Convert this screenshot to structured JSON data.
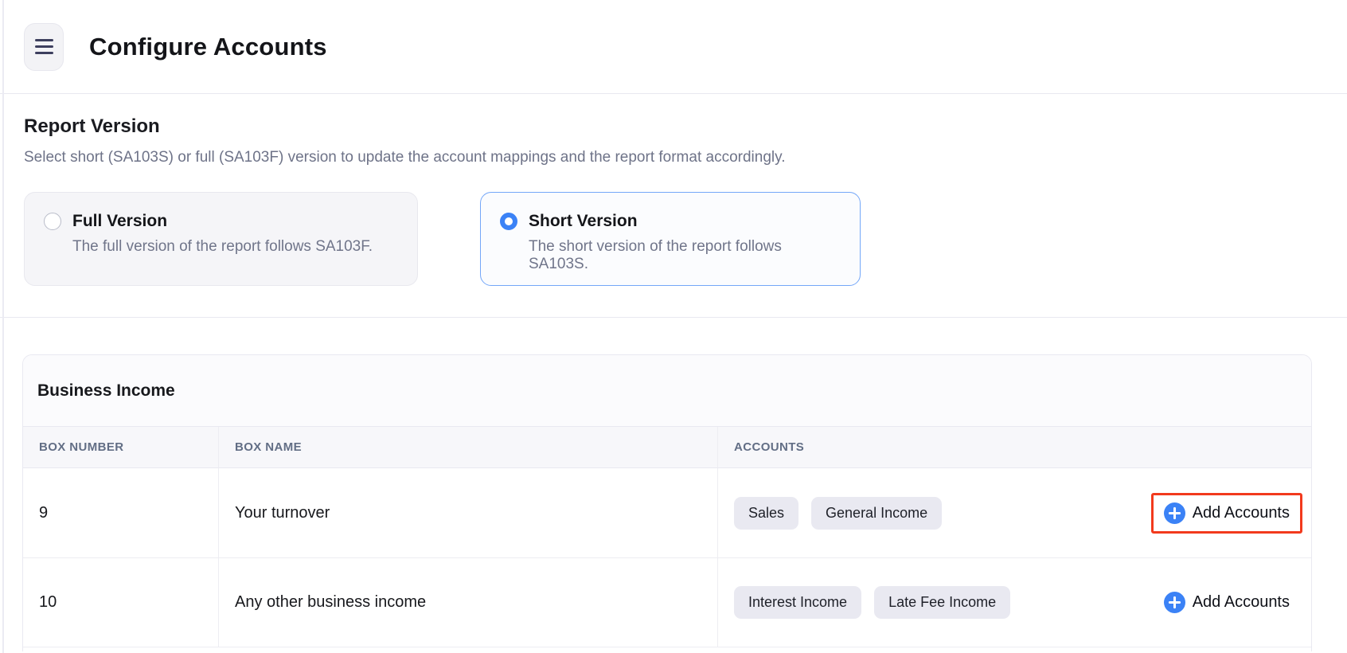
{
  "header": {
    "title": "Configure Accounts"
  },
  "report_version": {
    "title": "Report Version",
    "description": "Select short (SA103S) or full (SA103F) version to update the account mappings and the report format accordingly.",
    "options": [
      {
        "label": "Full Version",
        "description": "The full version of the report follows SA103F.",
        "selected": false
      },
      {
        "label": "Short Version",
        "description": "The short version of the report follows SA103S.",
        "selected": true
      }
    ]
  },
  "business_income": {
    "title": "Business Income",
    "columns": [
      "BOX NUMBER",
      "BOX NAME",
      "ACCOUNTS"
    ],
    "rows": [
      {
        "box_number": "9",
        "box_name": "Your turnover",
        "accounts": [
          "Sales",
          "General Income"
        ],
        "add_label": "Add Accounts",
        "highlighted": true
      },
      {
        "box_number": "10",
        "box_name": "Any other business income",
        "accounts": [
          "Interest Income",
          "Late Fee Income"
        ],
        "add_label": "Add Accounts",
        "highlighted": false
      }
    ]
  },
  "colors": {
    "accent_blue": "#3b82f6",
    "highlight_red": "#f23a1d"
  }
}
